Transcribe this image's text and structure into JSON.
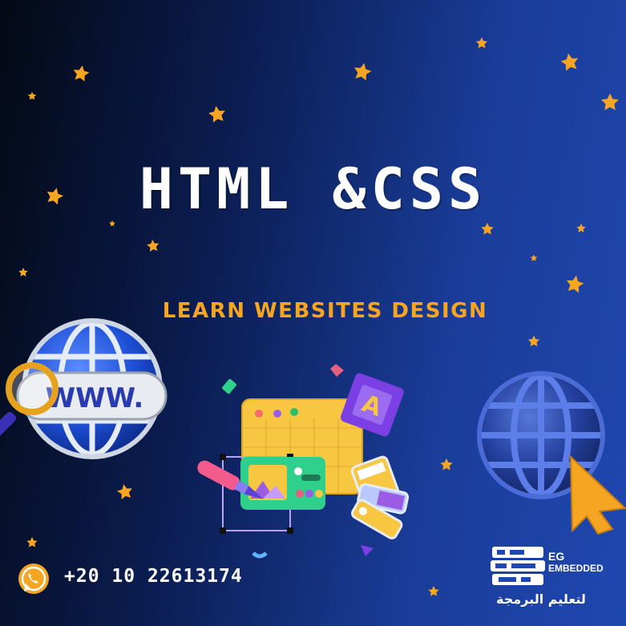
{
  "headline": "HTML &CSS",
  "tagline": "LEARN WEBSITES DESIGN",
  "contact": {
    "phone": "+20 10 22613174",
    "icon": "whatsapp-icon"
  },
  "logo": {
    "line1": "EG",
    "line2": "EMBEDDED",
    "tagline_ar": "لتعليم البرمجة"
  },
  "browser_url": "WWW.",
  "design_letter": "A",
  "colors": {
    "accent": "#f5a522",
    "background_dark": "#030914",
    "background_light": "#1f47b0",
    "text": "#ffffff"
  }
}
